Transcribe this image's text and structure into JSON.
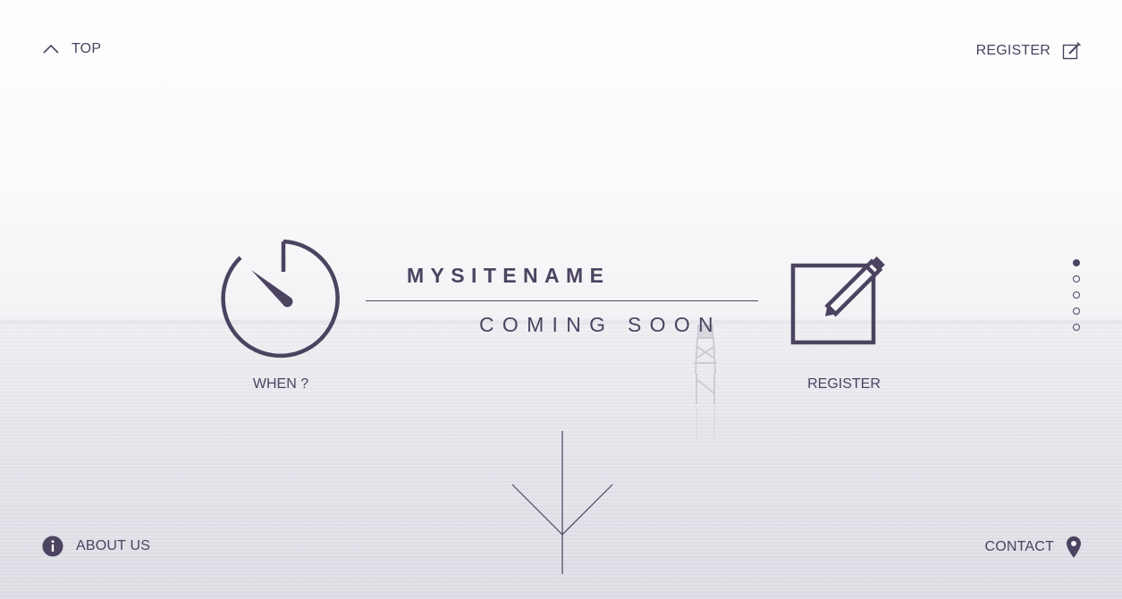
{
  "nav": {
    "top_label": "TOP",
    "register_label": "REGISTER",
    "about_label": "ABOUT US",
    "contact_label": "CONTACT"
  },
  "hero": {
    "site_name": "MYSITENAME",
    "tagline": "COMING SOON",
    "when_label": "WHEN ?",
    "register_label": "REGISTER"
  },
  "dots": [
    {
      "active": true
    },
    {
      "active": false
    },
    {
      "active": false
    },
    {
      "active": false
    },
    {
      "active": false
    }
  ],
  "icons": {
    "top": "chevron-up-icon",
    "register": "edit-icon",
    "about": "info-icon",
    "contact": "location-pin-icon",
    "when": "timer-icon",
    "scroll": "arrow-down-icon"
  },
  "colors": {
    "accent": "#4b4360",
    "background": "#f3f3f6"
  }
}
